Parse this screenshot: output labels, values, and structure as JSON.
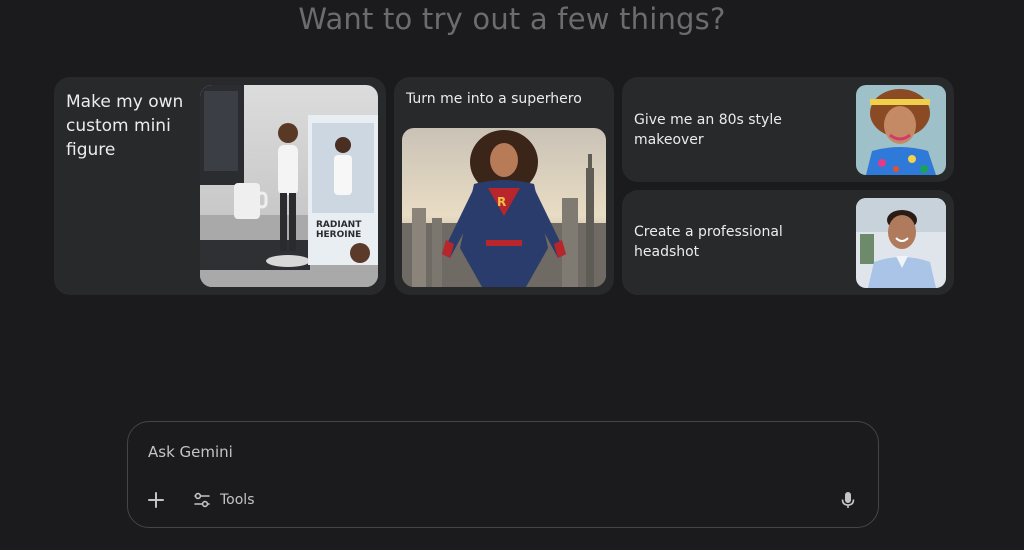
{
  "headline": "Want to try out a few things?",
  "suggestions": [
    {
      "label": "Make my own custom mini figure",
      "thumbnail": "mini-figure-photo",
      "thumbnail_text": "RADIANT HEROINE COLLECTION"
    },
    {
      "label": "Turn me into a superhero",
      "thumbnail": "superhero-photo"
    },
    {
      "label": "Give me an 80s style makeover",
      "thumbnail": "80s-makeover-photo"
    },
    {
      "label": "Create a professional headshot",
      "thumbnail": "headshot-photo"
    }
  ],
  "prompt": {
    "placeholder": "Ask Gemini",
    "tools_label": "Tools",
    "icons": [
      "plus-icon",
      "tools-icon",
      "microphone-icon"
    ]
  },
  "colors": {
    "background": "#1b1b1d",
    "card": "#28292b",
    "headline": "#6b6b70",
    "text": "#ececec",
    "border": "#444549"
  }
}
